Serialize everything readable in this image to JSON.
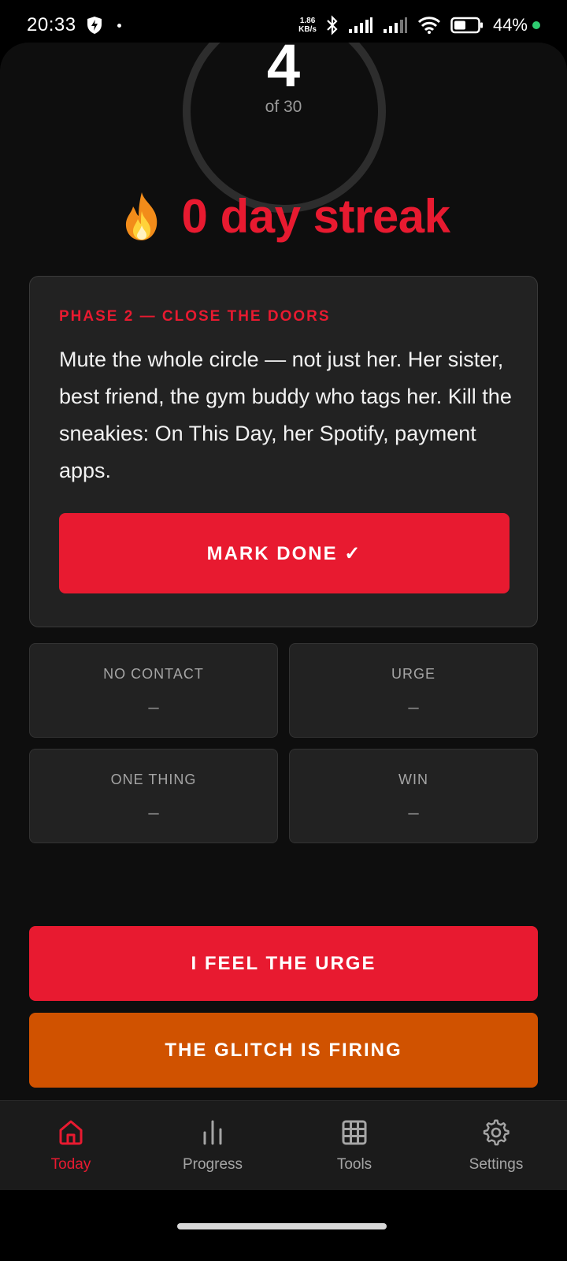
{
  "status_bar": {
    "time": "20:33",
    "net_speed_value": "1.86",
    "net_speed_unit": "KB/s",
    "battery": "44%"
  },
  "progress": {
    "day": "4",
    "of_text": "of 30"
  },
  "streak": {
    "text": "0 day streak"
  },
  "phase": {
    "label": "PHASE 2 — CLOSE THE DOORS",
    "text": "Mute the whole circle — not just her. Her sister, best friend, the gym buddy who tags her. Kill the sneakies: On This Day, her Spotify, payment apps.",
    "button_label": "MARK DONE ✓"
  },
  "stats": [
    {
      "label": "NO CONTACT",
      "value": "–"
    },
    {
      "label": "URGE",
      "value": "–"
    },
    {
      "label": "ONE THING",
      "value": "–"
    },
    {
      "label": "WIN",
      "value": "–"
    }
  ],
  "actions": {
    "urge_label": "I FEEL THE URGE",
    "glitch_label": "THE GLITCH IS FIRING"
  },
  "nav": [
    {
      "label": "Today",
      "icon": "home-icon",
      "active": true
    },
    {
      "label": "Progress",
      "icon": "bar-chart-icon",
      "active": false
    },
    {
      "label": "Tools",
      "icon": "grid-icon",
      "active": false
    },
    {
      "label": "Settings",
      "icon": "gear-icon",
      "active": false
    }
  ],
  "colors": {
    "accent": "#e81a30",
    "warning": "#d05200",
    "background": "#0e0e0e",
    "card": "#222222"
  }
}
